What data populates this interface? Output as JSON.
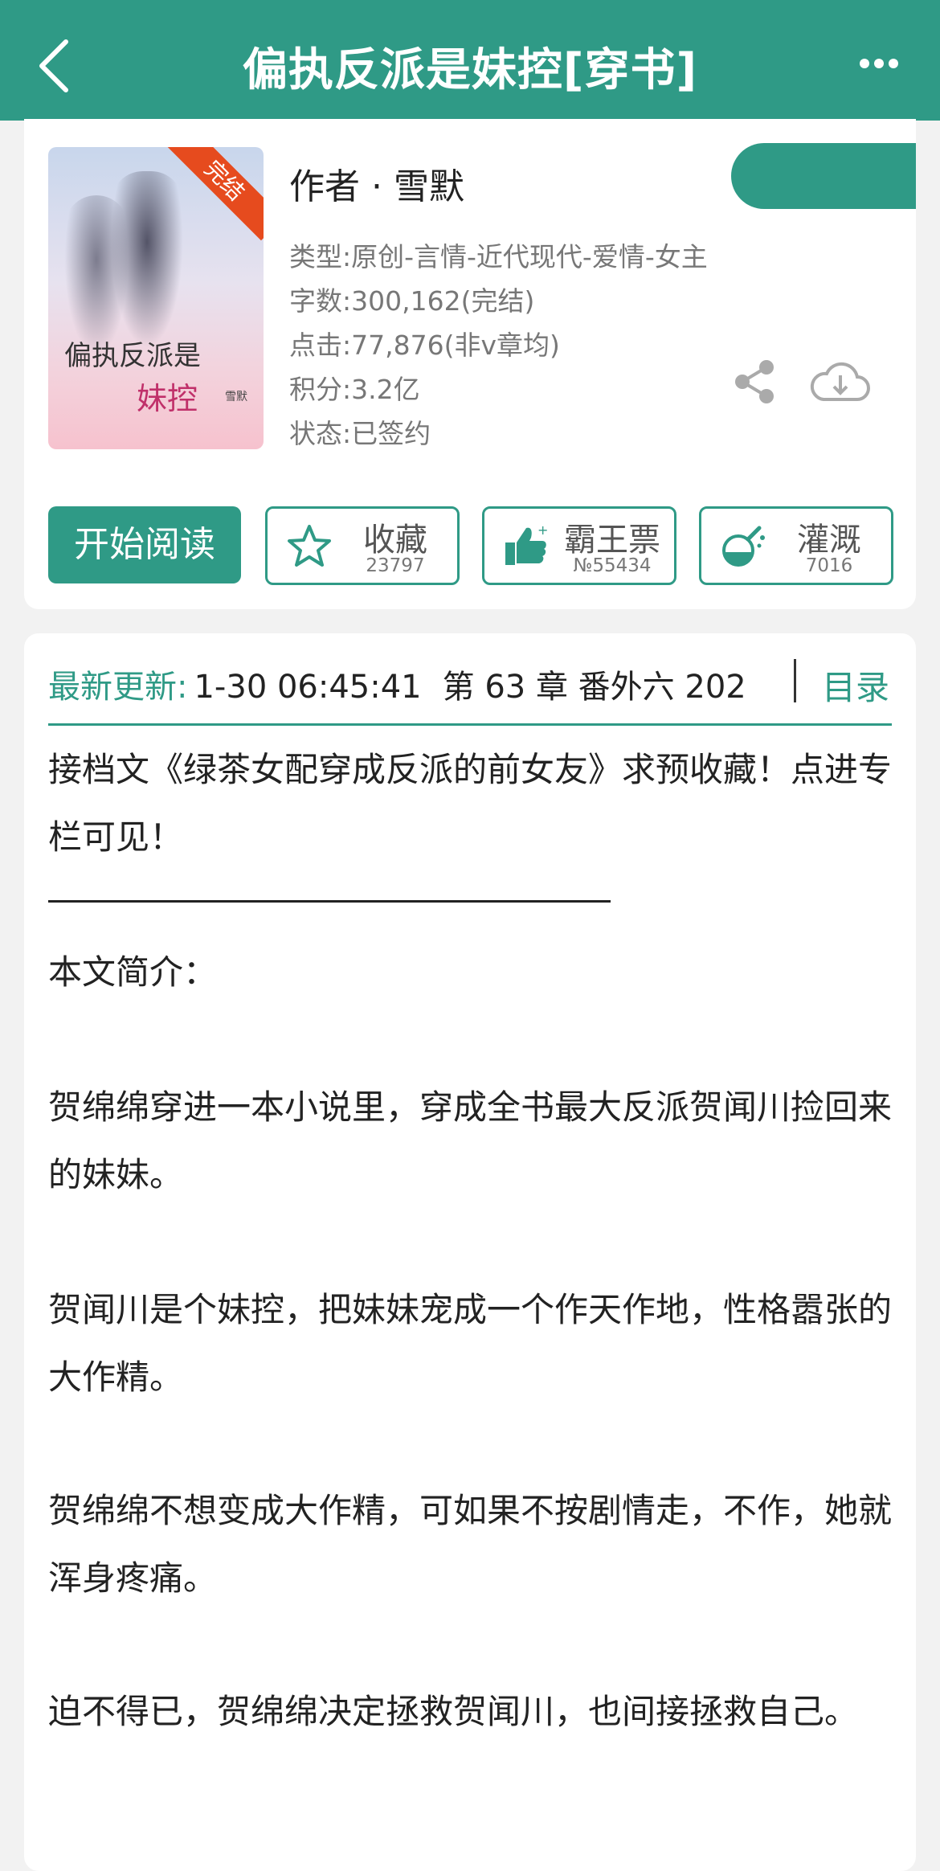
{
  "header": {
    "title": "偏执反派是妹控[穿书]"
  },
  "book": {
    "cover": {
      "ribbon": "完结",
      "title_line1": "偏执反派是",
      "title_line2": "妹控",
      "signature": "雪默"
    },
    "author": "作者 · 雪默",
    "meta": [
      "类型:原创-言情-近代现代-爱情-女主",
      "字数:300,162(完结)",
      "点击:77,876(非v章均)",
      "积分:3.2亿",
      "状态:已签约"
    ]
  },
  "actions": {
    "read_label": "开始阅读",
    "favorite": {
      "label": "收藏",
      "count": "23797"
    },
    "vote": {
      "label": "霸王票",
      "count": "№55434"
    },
    "nutrient": {
      "label": "灌溉",
      "count": "7016"
    }
  },
  "update": {
    "label": "最新更新:",
    "time": "1-30 06:45:41",
    "chapter": "第 63 章 番外六 202",
    "toc_label": "目录"
  },
  "intro": {
    "notice": "接档文《绿茶女配穿成反派的前女友》求预收藏！点进专栏可见！",
    "heading": "本文简介：",
    "paragraphs": [
      "贺绵绵穿进一本小说里，穿成全书最大反派贺闻川捡回来的妹妹。",
      "贺闻川是个妹控，把妹妹宠成一个作天作地，性格嚣张的大作精。",
      "贺绵绵不想变成大作精，可如果不按剧情走，不作，她就浑身疼痛。",
      "迫不得已，贺绵绵决定拯救贺闻川，也间接拯救自己。"
    ]
  },
  "colors": {
    "accent": "#2f9a86",
    "ribbon": "#e64b1e"
  },
  "icons": [
    "back-icon",
    "more-icon",
    "share-icon",
    "download-icon",
    "star-icon",
    "thumbs-up-icon",
    "flask-icon"
  ]
}
